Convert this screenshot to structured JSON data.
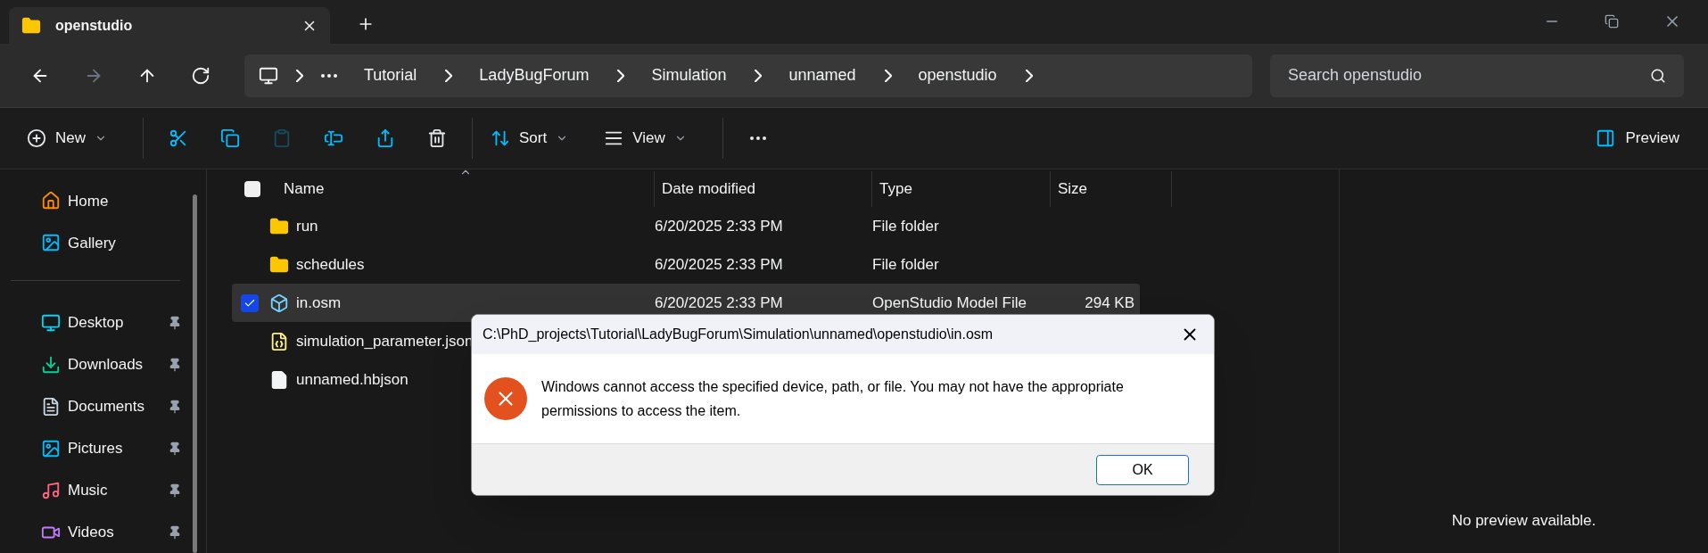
{
  "tab": {
    "title": "openstudio"
  },
  "nav": [
    {
      "kind": "back",
      "disabled": false
    },
    {
      "kind": "forward",
      "disabled": true
    },
    {
      "kind": "up",
      "disabled": false
    },
    {
      "kind": "refresh",
      "disabled": false
    }
  ],
  "breadcrumbs": [
    "Tutorial",
    "LadyBugForum",
    "Simulation",
    "unnamed",
    "openstudio"
  ],
  "search": {
    "placeholder": "Search openstudio"
  },
  "toolbar": [
    {
      "kind": "new",
      "label": "New",
      "disabled": false
    },
    {
      "kind": "cut",
      "disabled": false
    },
    {
      "kind": "copy",
      "disabled": false
    },
    {
      "kind": "paste",
      "disabled": true
    },
    {
      "kind": "rename",
      "disabled": false
    },
    {
      "kind": "share",
      "disabled": false
    },
    {
      "kind": "delete",
      "disabled": false
    },
    {
      "kind": "sort",
      "label": "Sort",
      "disabled": false
    },
    {
      "kind": "view",
      "label": "View",
      "disabled": false
    },
    {
      "kind": "more",
      "disabled": false
    }
  ],
  "preview_button": "Preview",
  "sidebar": {
    "groups": [
      [
        {
          "label": "Home",
          "kind": "home",
          "pinned": false
        },
        {
          "label": "Gallery",
          "kind": "gallery",
          "pinned": false
        }
      ],
      [
        {
          "label": "Desktop",
          "kind": "desktop",
          "pinned": true
        },
        {
          "label": "Downloads",
          "kind": "downloads",
          "pinned": true
        },
        {
          "label": "Documents",
          "kind": "documents",
          "pinned": true
        },
        {
          "label": "Pictures",
          "kind": "pictures",
          "pinned": true
        },
        {
          "label": "Music",
          "kind": "music",
          "pinned": true
        },
        {
          "label": "Videos",
          "kind": "videos",
          "pinned": true
        }
      ]
    ]
  },
  "columns": [
    {
      "label": "Name",
      "sorted": true
    },
    {
      "label": "Date modified",
      "sorted": false
    },
    {
      "label": "Type",
      "sorted": false
    },
    {
      "label": "Size",
      "sorted": false
    }
  ],
  "all_checked": false,
  "rows": [
    {
      "name": "run",
      "kind": "folder",
      "date": "6/20/2025 2:33 PM",
      "type": "File folder",
      "selected": false
    },
    {
      "name": "schedules",
      "kind": "folder",
      "date": "6/20/2025 2:33 PM",
      "type": "File folder",
      "selected": false
    },
    {
      "name": "in.osm",
      "kind": "osm",
      "date": "6/20/2025 2:33 PM",
      "type": "OpenStudio Model File",
      "size": "294 KB",
      "selected": true
    },
    {
      "name": "simulation_parameter.json",
      "kind": "json",
      "selected": false
    },
    {
      "name": "unnamed.hbjson",
      "kind": "file",
      "selected": false
    }
  ],
  "preview": {
    "message": "No preview available."
  },
  "dialog": {
    "title": "C:\\PhD_projects\\Tutorial\\LadyBugForum\\Simulation\\unnamed\\openstudio\\in.osm",
    "message": "Windows cannot access the specified device, path, or file. You may not have the appropriate permissions to access the item.",
    "button": "OK"
  }
}
